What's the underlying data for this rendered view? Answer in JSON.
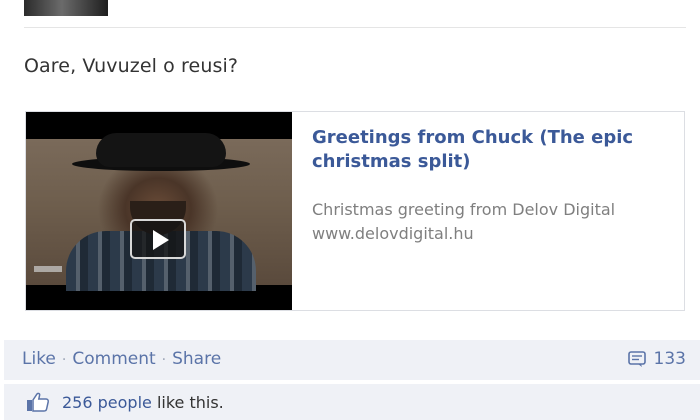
{
  "post": {
    "message": "Oare, Vuvuzel o reusi?"
  },
  "share": {
    "title": "Greetings from Chuck (The epic christmas split)",
    "description": "Christmas greeting from Delov Digital",
    "url": "www.delovdigital.hu",
    "thumbnail_icon": "play-icon"
  },
  "actions": {
    "like": "Like",
    "comment": "Comment",
    "share": "Share",
    "separator": "·",
    "comment_count": "133",
    "comment_icon": "comment-icon"
  },
  "likes": {
    "count_text": "256 people",
    "suffix": " like this.",
    "icon": "thumbs-up-icon"
  },
  "colors": {
    "link": "#3b5998",
    "action_bar_bg": "#eff1f6",
    "muted_text": "#7f7f7f"
  }
}
